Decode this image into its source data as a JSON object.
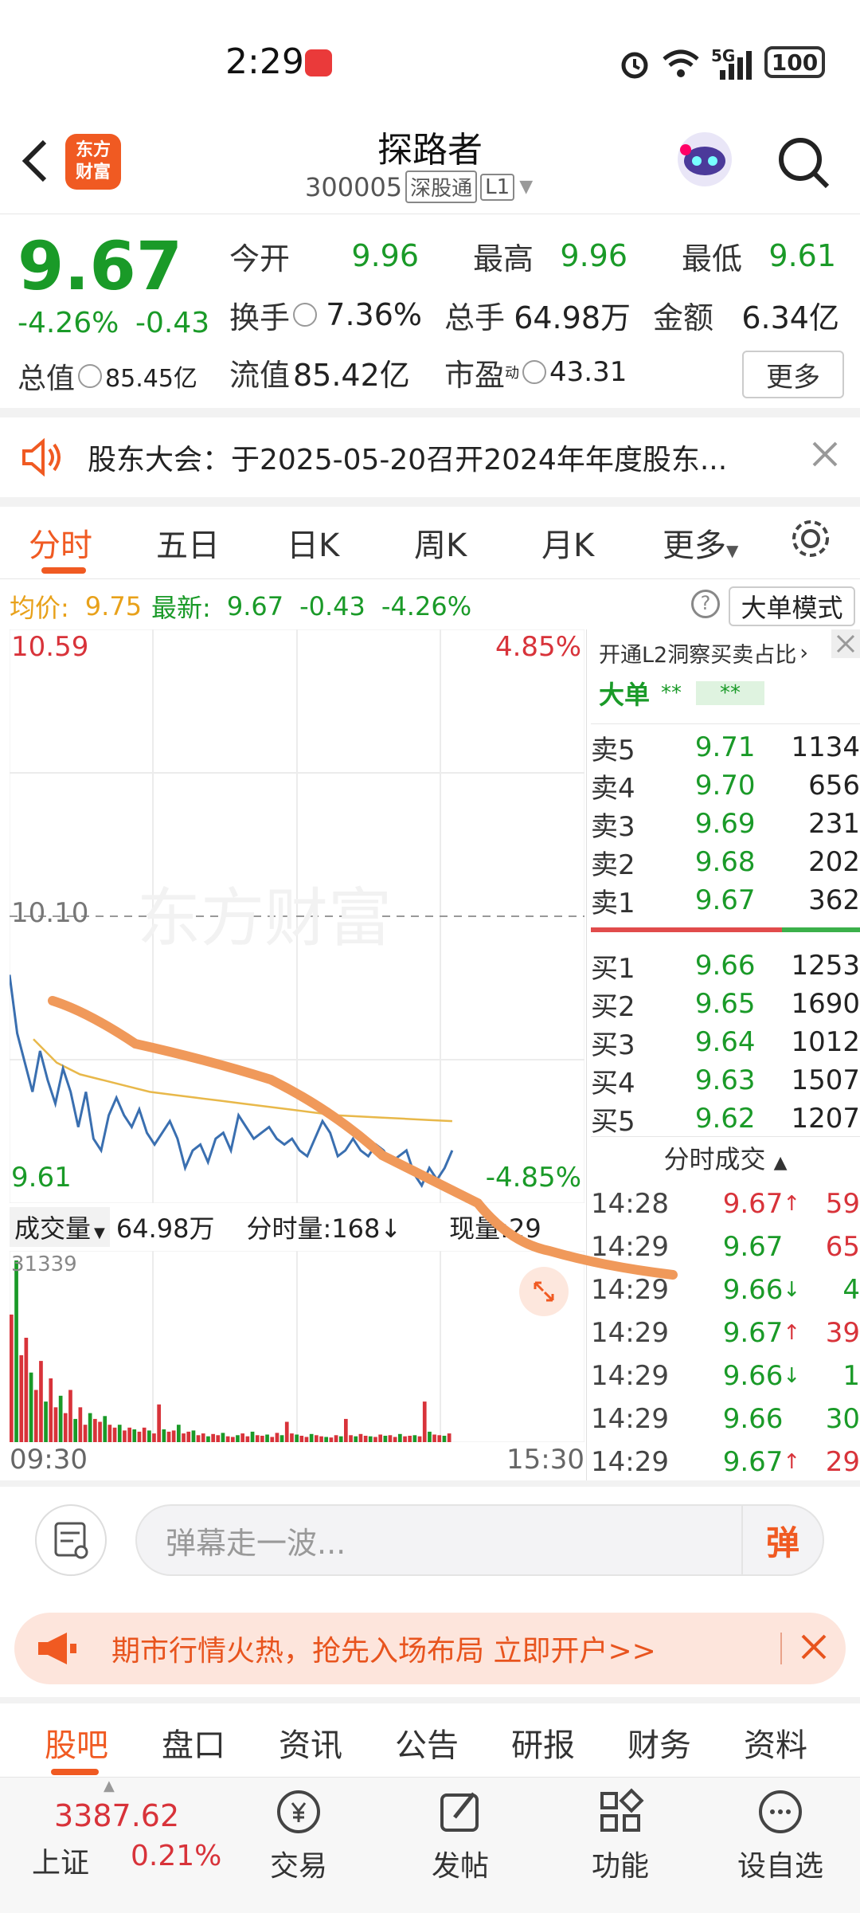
{
  "status_bar": {
    "time": "2:29",
    "battery": "100",
    "network": "5G"
  },
  "header": {
    "title": "探路者",
    "code": "300005",
    "exchange_tag": "深股通",
    "level_tag": "L1",
    "logo_text_top": "东方",
    "logo_text_bottom": "财富"
  },
  "quote": {
    "price": "9.67",
    "change_pct": "-4.26%",
    "change": "-0.43",
    "open_label": "今开",
    "open": "9.96",
    "high_label": "最高",
    "high": "9.96",
    "low_label": "最低",
    "low": "9.61",
    "turnover_label": "换手",
    "turnover": "7.36%",
    "volume_label": "总手",
    "volume": "64.98万",
    "amount_label": "金额",
    "amount": "6.34亿",
    "mktcap_label": "总值",
    "mktcap": "85.45亿",
    "float_label": "流值",
    "float_cap": "85.42亿",
    "pe_label": "市盈",
    "pe_sup": "动",
    "pe": "43.31",
    "more_label": "更多"
  },
  "notice": {
    "text": "股东大会：于2025-05-20召开2024年年度股东..."
  },
  "chart_tabs": [
    "分时",
    "五日",
    "日K",
    "周K",
    "月K",
    "更多"
  ],
  "chart_info": {
    "avg_label": "均价:",
    "avg": "9.75",
    "latest_label": "最新:",
    "latest": "9.67",
    "chg": "-0.43",
    "pct": "-4.26%",
    "mode_label": "大单模式"
  },
  "chart_data": {
    "type": "line",
    "y_max_label": "10.59",
    "y_mid_label": "10.10",
    "y_min_label": "9.61",
    "pct_max_label": "4.85%",
    "pct_min_label": "-4.85%",
    "ylim": [
      9.61,
      10.59
    ],
    "x_start_label": "09:30",
    "x_end_label": "15:30",
    "series": [
      {
        "values": [
          10.0,
          9.9,
          9.85,
          9.8,
          9.87,
          9.82,
          9.78,
          9.84,
          9.8,
          9.74,
          9.8,
          9.72,
          9.7,
          9.76,
          9.79,
          9.76,
          9.74,
          9.77,
          9.73,
          9.71,
          9.73,
          9.75,
          9.72,
          9.67,
          9.7,
          9.71,
          9.68,
          9.72,
          9.73,
          9.7,
          9.76,
          9.74,
          9.72,
          9.73,
          9.74,
          9.72,
          9.71,
          9.72,
          9.7,
          9.69,
          9.72,
          9.75,
          9.73,
          9.69,
          9.7,
          9.72,
          9.7,
          9.69,
          9.71,
          9.7,
          9.68,
          9.69,
          9.7,
          9.66,
          9.64,
          9.67,
          9.65,
          9.67,
          9.7
        ]
      },
      {
        "values": [
          9.89,
          9.85,
          9.83,
          9.82,
          9.81,
          9.8,
          9.795,
          9.79,
          9.785,
          9.78,
          9.775,
          9.77,
          9.765,
          9.76,
          9.758,
          9.756,
          9.754,
          9.752,
          9.75
        ]
      }
    ],
    "volume_label": "成交量",
    "volume_total": "64.98万",
    "tick_volume_label": "分时量:168↓",
    "current_volume_label": "现量:29",
    "volume_max_label": "31339",
    "volume_bars": [
      22000,
      31339,
      15000,
      18000,
      12000,
      9000,
      14000,
      7000,
      11000,
      6000,
      8000,
      5000,
      9000,
      4000,
      6000,
      3000,
      5000,
      4000,
      3500,
      4500,
      3000,
      2500,
      3000,
      2000,
      2500,
      2200,
      1800,
      2500,
      2000,
      1500,
      6500,
      2200,
      1800,
      2000,
      3000,
      1500,
      1800,
      2000,
      1200,
      1500,
      1000,
      1400,
      1200,
      1600,
      1000,
      900,
      1200,
      1500,
      1000,
      1800,
      1200,
      1100,
      1300,
      900,
      1600,
      1200,
      3500,
      1500,
      1300,
      1100,
      900,
      1400,
      1200,
      1000,
      900,
      800,
      1200,
      1000,
      4000,
      1200,
      1000,
      1400,
      1100,
      1000,
      900,
      1300,
      1100,
      1200,
      900,
      1400,
      1000,
      1100,
      1200,
      1000,
      7000,
      1800,
      1300,
      1200,
      1100,
      1500
    ]
  },
  "orderbook": {
    "promo": "开通L2洞察买卖占比",
    "big_label": "大单",
    "big_a": "**",
    "big_b": "**",
    "sells": [
      {
        "label": "卖5",
        "price": "9.71",
        "vol": "1134"
      },
      {
        "label": "卖4",
        "price": "9.70",
        "vol": "656"
      },
      {
        "label": "卖3",
        "price": "9.69",
        "vol": "231"
      },
      {
        "label": "卖2",
        "price": "9.68",
        "vol": "202"
      },
      {
        "label": "卖1",
        "price": "9.67",
        "vol": "362"
      }
    ],
    "buys": [
      {
        "label": "买1",
        "price": "9.66",
        "vol": "1253"
      },
      {
        "label": "买2",
        "price": "9.65",
        "vol": "1690"
      },
      {
        "label": "买3",
        "price": "9.64",
        "vol": "1012"
      },
      {
        "label": "买4",
        "price": "9.63",
        "vol": "1507"
      },
      {
        "label": "买5",
        "price": "9.62",
        "vol": "1207"
      }
    ],
    "trades_title": "分时成交",
    "trades": [
      {
        "time": "14:28",
        "price": "9.67",
        "arrow": "↑",
        "vol": "59",
        "dir": "up"
      },
      {
        "time": "14:29",
        "price": "9.67",
        "arrow": "",
        "vol": "65",
        "dir": "flat"
      },
      {
        "time": "14:29",
        "price": "9.66",
        "arrow": "↓",
        "vol": "4",
        "dir": "down"
      },
      {
        "time": "14:29",
        "price": "9.67",
        "arrow": "↑",
        "vol": "39",
        "dir": "up"
      },
      {
        "time": "14:29",
        "price": "9.66",
        "arrow": "↓",
        "vol": "1",
        "dir": "down"
      },
      {
        "time": "14:29",
        "price": "9.66",
        "arrow": "",
        "vol": "30",
        "dir": "flat"
      },
      {
        "time": "14:29",
        "price": "9.67",
        "arrow": "↑",
        "vol": "29",
        "dir": "up"
      }
    ]
  },
  "danmu": {
    "placeholder": "弹幕走一波...",
    "button": "弹"
  },
  "ad": {
    "text": "期市行情火热，抢先入场布局 立即开户>>"
  },
  "bottom_tabs": [
    "股吧",
    "盘口",
    "资讯",
    "公告",
    "研报",
    "财务",
    "资料"
  ],
  "nav": {
    "index_value": "3387.62",
    "index_name": "上证",
    "index_pct": "0.21%",
    "trade": "交易",
    "post": "发帖",
    "func": "功能",
    "watch": "设自选"
  }
}
